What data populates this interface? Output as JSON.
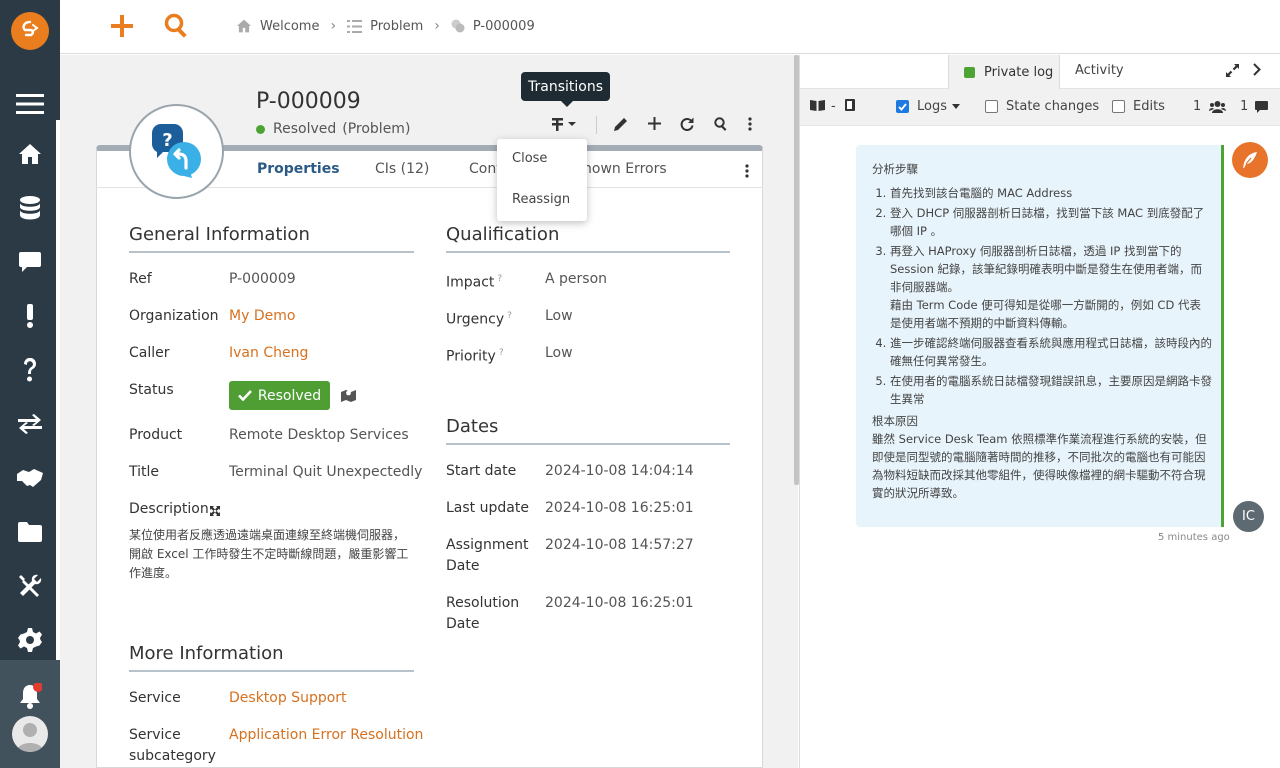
{
  "topbar": {
    "breadcrumb": [
      "Welcome",
      "Problem",
      "P-000009"
    ]
  },
  "object": {
    "ref_title": "P-000009",
    "status_text": "Resolved",
    "class_text": "(Problem)"
  },
  "tooltip": "Transitions",
  "menu": [
    "Close",
    "Reassign"
  ],
  "tabs": [
    "Properties",
    "CIs (12)",
    "Cont",
    "nown Errors"
  ],
  "general": {
    "heading": "General Information",
    "fields": [
      {
        "label": "Ref",
        "value": "P-000009"
      },
      {
        "label": "Organization",
        "value": "My Demo"
      },
      {
        "label": "Caller",
        "value": "Ivan Cheng"
      },
      {
        "label": "Status",
        "value": "Resolved"
      },
      {
        "label": "Product",
        "value": "Remote Desktop Services"
      },
      {
        "label": "Title",
        "value": "Terminal Quit Unexpectedly"
      },
      {
        "label": "Description",
        "value": "某位使用者反應透過遠端桌面連線至終端機伺服器，開啟 Excel 工作時發生不定時斷線問題，嚴重影響工作進度。"
      }
    ]
  },
  "more": {
    "heading": "More Information",
    "fields": [
      {
        "label": "Service",
        "value": "Desktop Support"
      },
      {
        "label": "Service subcategory",
        "value": "Application Error Resolution"
      }
    ]
  },
  "qualification": {
    "heading": "Qualification",
    "fields": [
      {
        "label": "Impact",
        "value": "A person"
      },
      {
        "label": "Urgency",
        "value": "Low"
      },
      {
        "label": "Priority",
        "value": "Low"
      }
    ]
  },
  "dates": {
    "heading": "Dates",
    "fields": [
      {
        "label": "Start date",
        "value": "2024-10-08 14:04:14"
      },
      {
        "label": "Last update",
        "value": "2024-10-08 16:25:01"
      },
      {
        "label": "Assignment Date",
        "value": "2024-10-08 14:57:27"
      },
      {
        "label": "Resolution Date",
        "value": "2024-10-08 16:25:01"
      }
    ]
  },
  "right": {
    "tab_private": "Private log",
    "tab_activity": "Activity",
    "filters": {
      "logs": "Logs",
      "state_changes": "State changes",
      "edits": "Edits",
      "user_count": "1",
      "comment_count": "1",
      "dash": "-"
    },
    "entry": {
      "heading": "分析步驟",
      "steps": [
        "首先找到該台電腦的 MAC Address",
        "登入 DHCP 伺服器剖析日誌檔，找到當下該 MAC 到底發配了哪個 IP 。",
        "再登入 HAProxy 伺服器剖析日誌檔，透過 IP 找到當下的 Session 紀錄，該筆紀錄明確表明中斷是發生在使用者端，而非伺服器端。",
        "進一步確認終端伺服器查看系統與應用程式日誌檔，該時段內的確無任何異常發生。",
        "在使用者的電腦系統日誌檔發現錯誤訊息，主要原因是網路卡發生異常"
      ],
      "step3_extra": "藉由 Term Code 便可得知是從哪一方斷開的，例如 CD 代表是使用者端不預期的中斷資料傳輸。",
      "root_heading": "根本原因",
      "root_text": "雖然 Service Desk Team 依照標準作業流程進行系統的安裝，但即使是同型號的電腦隨著時間的推移，不同批次的電腦也有可能因為物料短缺而改採其他零組件，使得映像檔裡的網卡驅動不符合現實的狀況所導致。",
      "author_initials": "IC",
      "time_ago": "5 minutes ago"
    }
  },
  "colors": {
    "sidebar": "#2b3a45",
    "accent": "#ea7d1e",
    "link": "#d6711f",
    "resolved": "#4e9e34",
    "active_tab": "#2c5a86"
  }
}
